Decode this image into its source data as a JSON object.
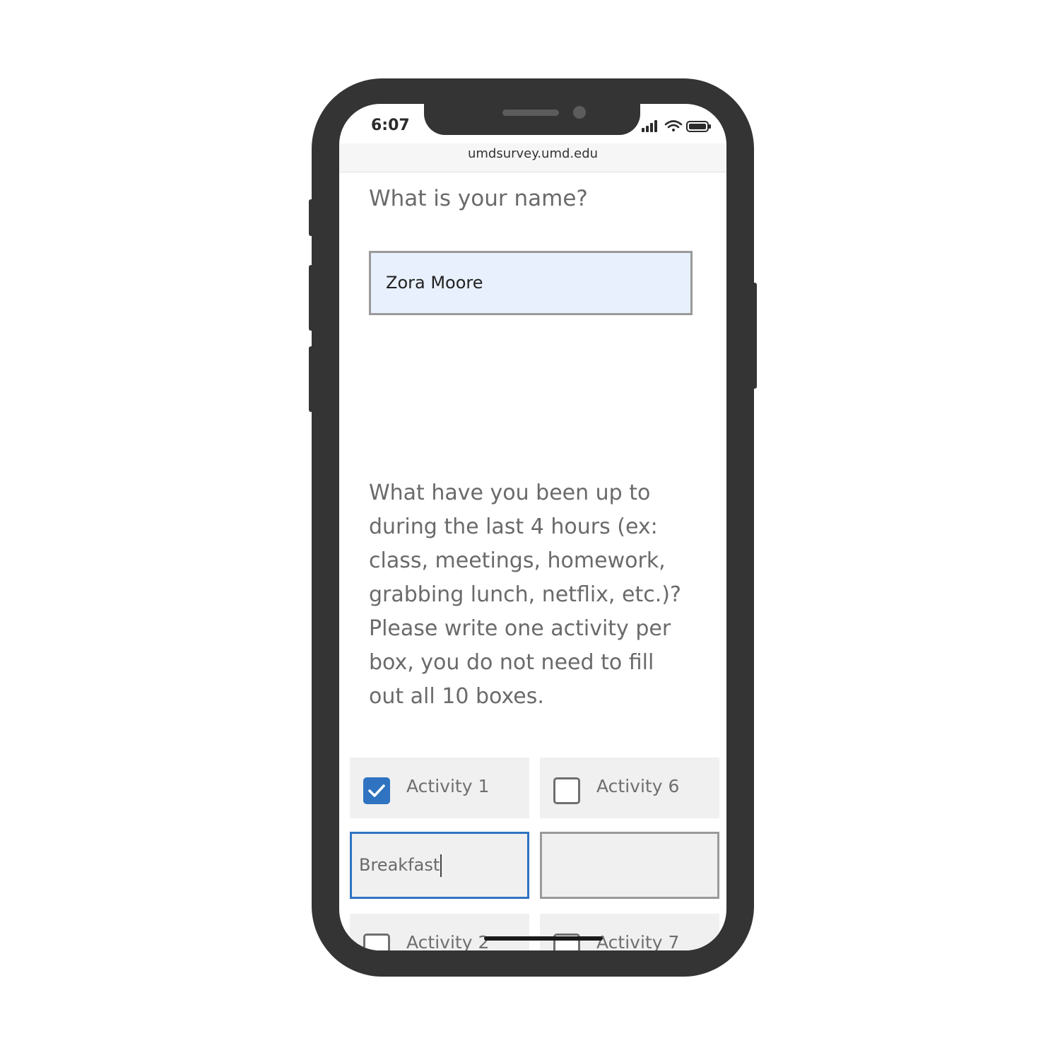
{
  "status_bar": {
    "time": "6:07",
    "icons": [
      "signal-icon",
      "wifi-icon",
      "battery-icon"
    ]
  },
  "browser": {
    "url": "umdsurvey.umd.edu"
  },
  "question_name": {
    "text": "What is your name?",
    "answer_value": "Zora Moore"
  },
  "question_activities": {
    "lines": [
      "What have you been up to",
      "during the last 4 hours (ex:",
      "class, meetings, homework,",
      "grabbing lunch, netflix, etc.)?",
      "Please write one activity per",
      "box, you do not need to fill",
      "out all 10 boxes."
    ]
  },
  "activities": [
    {
      "label": "Activity 1",
      "checked": true,
      "value": "Breakfast"
    },
    {
      "label": "Activity 6",
      "checked": false,
      "value": ""
    },
    {
      "label": "Activity 2",
      "checked": false
    },
    {
      "label": "Activity 7",
      "checked": false
    }
  ],
  "colors": {
    "phone_frame": "#343434",
    "accent_blue": "#2f73c1",
    "autofill_bg": "#e8f0fe",
    "cell_bg": "#f0f0f0",
    "question_text": "#6a6a6a"
  }
}
